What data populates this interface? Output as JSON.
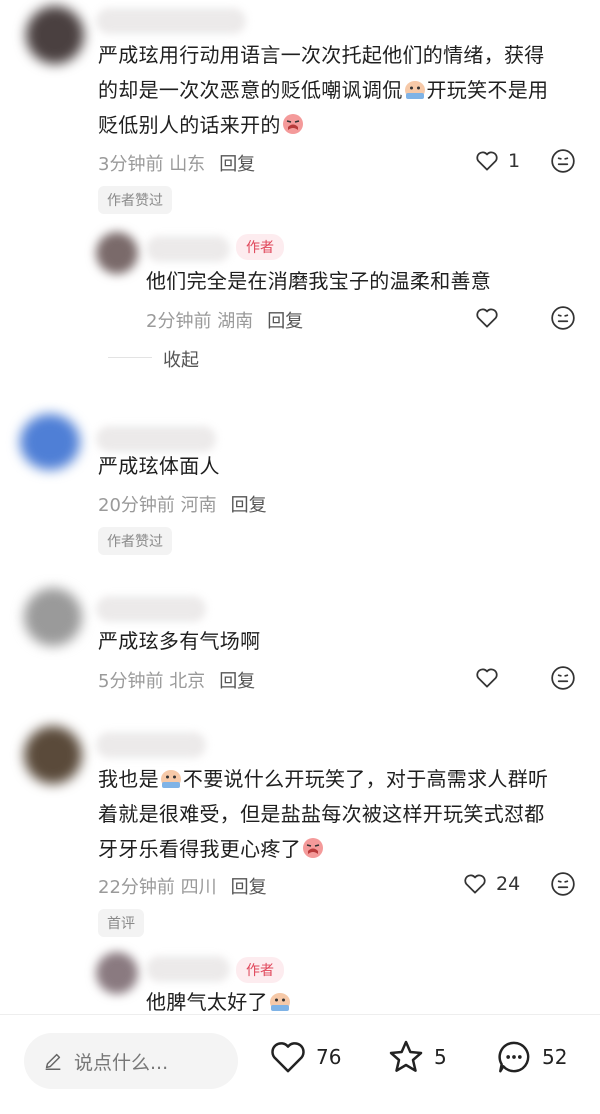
{
  "comments": [
    {
      "text_lines": [
        "严成玹用行动用语言一次次托起他们的情绪，获得",
        "的却是一次次恶意的贬低嘲讽调侃",
        "开玩笑不是用",
        "贬低别人的话来开的"
      ],
      "time": "3分钟前",
      "location": "山东",
      "reply_label": "回复",
      "likes": "1",
      "tag": "作者赞过",
      "reply": {
        "badge": "作者",
        "text": "他们完全是在消磨我宝子的温柔和善意",
        "time": "2分钟前",
        "location": "湖南",
        "reply_label": "回复"
      },
      "collapse_label": "收起"
    },
    {
      "text": "严成玹体面人",
      "time": "20分钟前",
      "location": "河南",
      "reply_label": "回复",
      "tag": "作者赞过"
    },
    {
      "text": "严成玹多有气场啊",
      "time": "5分钟前",
      "location": "北京",
      "reply_label": "回复"
    },
    {
      "text_lines": [
        "我也是",
        "不要说什么开玩笑了，对于高需求人群听",
        "着就是很难受，但是盐盐每次被这样开玩笑式怼都",
        "牙牙乐看得我更心疼了"
      ],
      "time": "22分钟前",
      "location": "四川",
      "reply_label": "回复",
      "likes": "24",
      "tag": "首评",
      "reply": {
        "badge": "作者",
        "text": "他脾气太好了"
      }
    }
  ],
  "bottom_bar": {
    "input_placeholder": "说点什么...",
    "likes": "76",
    "stars": "5",
    "comments": "52"
  },
  "colors": {
    "author_badge": "#e0475b",
    "meta": "#9a9a9a"
  }
}
